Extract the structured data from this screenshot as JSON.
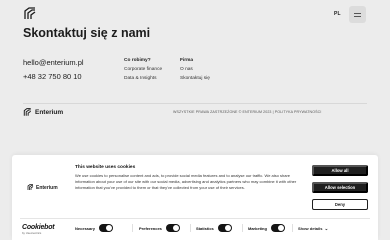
{
  "header": {
    "lang": "PL"
  },
  "contact": {
    "title": "Skontaktuj się z nami",
    "email": "hello@enterium.pl",
    "phone": "+48 32 750 80 10"
  },
  "columns": [
    {
      "heading": "Co robimy?",
      "items": [
        "Corporate finance",
        "Data & Insights"
      ]
    },
    {
      "heading": "Firma",
      "items": [
        "O nas",
        "Skontaktuj się"
      ]
    }
  ],
  "footer": {
    "brand": "Enterium",
    "legal": "WSZYSTKIE PRAWA ZASTRZEŻONE © ENTERIUM 2023 | POLITYKA PRYWATNOŚCI"
  },
  "cookie_banner": {
    "brand": "Enterium",
    "title": "This website uses cookies",
    "text": "We use cookies to personalise content and ads, to provide social media features and to analyse our traffic. We also share information about your use of our site with our social media, advertising and analytics partners who may combine it with other information that you've provided to them or that they've collected from your use of their services.",
    "buttons": {
      "allow_all": "Allow all",
      "allow_selection": "Allow selection",
      "deny": "Deny"
    },
    "cookiebot": {
      "logo": "Cookiebot",
      "sub": "by Usercentrics"
    },
    "toggles": [
      {
        "label": "Necessary",
        "on": true
      },
      {
        "label": "Preferences",
        "on": true
      },
      {
        "label": "Statistics",
        "on": true
      },
      {
        "label": "Marketing",
        "on": true
      }
    ],
    "details": "Show details"
  }
}
